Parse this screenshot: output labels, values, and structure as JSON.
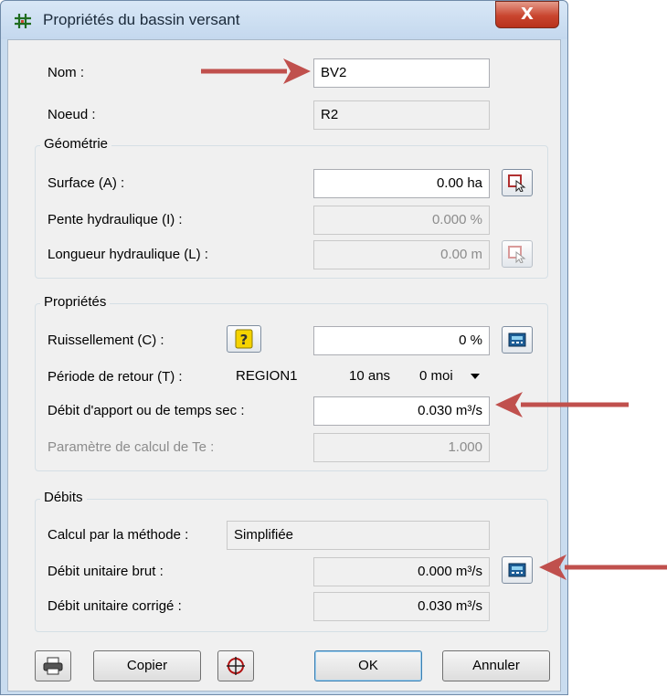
{
  "window": {
    "title": "Propriétés du bassin versant",
    "close_label": "X"
  },
  "fields": {
    "nom": {
      "label": "Nom :",
      "value": "BV2"
    },
    "noeud": {
      "label": "Noeud :",
      "value": "R2"
    }
  },
  "geometrie": {
    "legend": "Géométrie",
    "surface": {
      "label": "Surface (A) :",
      "value": "0.00 ha"
    },
    "pente": {
      "label": "Pente hydraulique (I) :",
      "value": "0.000 %"
    },
    "longueur": {
      "label": "Longueur hydraulique (L) :",
      "value": "0.00 m"
    }
  },
  "proprietes": {
    "legend": "Propriétés",
    "ruissellement": {
      "label": "Ruissellement (C) :",
      "value": "0 %"
    },
    "periode": {
      "label": "Période de retour (T) :",
      "region": "REGION1",
      "ans": "10 ans",
      "moi": "0 moi"
    },
    "debit_apport": {
      "label": "Débit d'apport ou de temps sec :",
      "value": "0.030 m³/s"
    },
    "parametre_te": {
      "label": "Paramètre de calcul de Te :",
      "value": "1.000"
    }
  },
  "debits": {
    "legend": "Débits",
    "methode": {
      "label": "Calcul par la méthode :",
      "value": "Simplifiée"
    },
    "brut": {
      "label": "Débit unitaire brut :",
      "value": "0.000 m³/s"
    },
    "corrige": {
      "label": "Débit unitaire corrigé :",
      "value": "0.030 m³/s"
    }
  },
  "buttons": {
    "copier": "Copier",
    "ok": "OK",
    "annuler": "Annuler"
  },
  "colors": {
    "annotation_arrow": "#c0504d",
    "title_bg": "#c9dcef"
  }
}
